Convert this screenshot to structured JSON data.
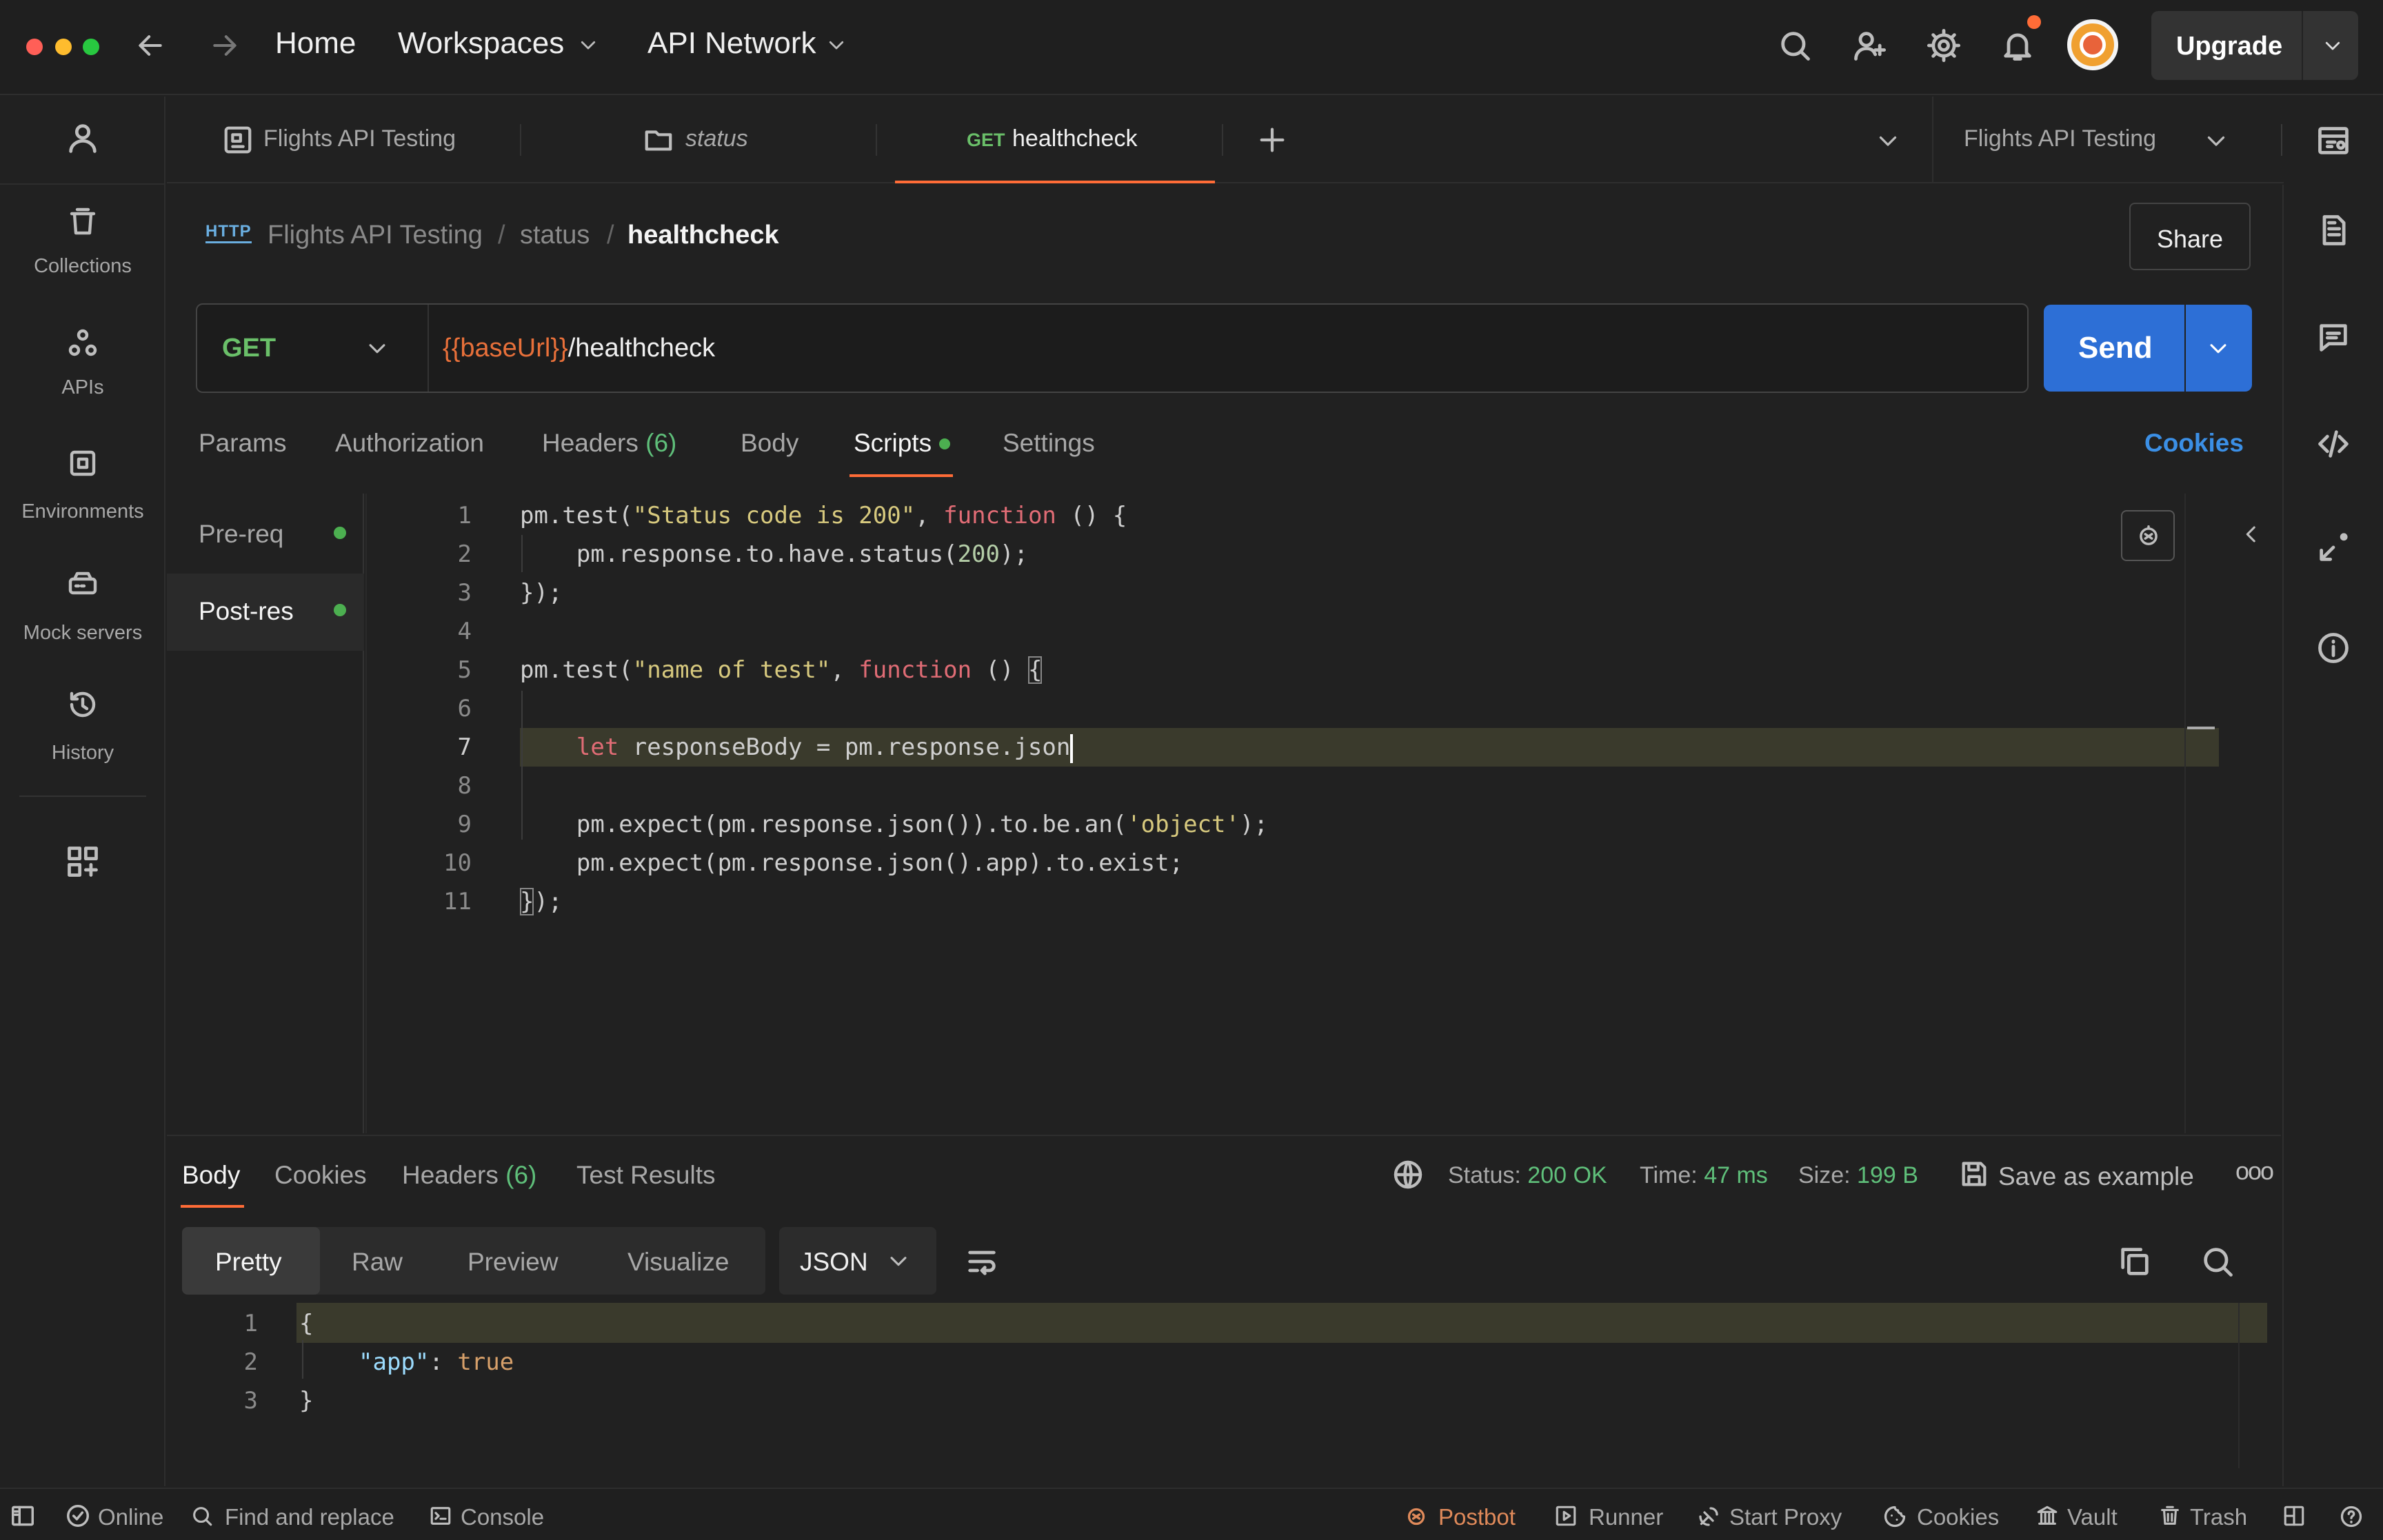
{
  "topbar": {
    "home": "Home",
    "workspaces": "Workspaces",
    "api_network": "API Network",
    "upgrade": "Upgrade"
  },
  "tabs": {
    "items": [
      {
        "label": "Flights API Testing"
      },
      {
        "label": "status"
      },
      {
        "method": "GET",
        "label": "healthcheck"
      }
    ],
    "environment": "Flights API Testing"
  },
  "sidebar": {
    "items": [
      {
        "label": "Collections"
      },
      {
        "label": "APIs"
      },
      {
        "label": "Environments"
      },
      {
        "label": "Mock servers"
      },
      {
        "label": "History"
      }
    ]
  },
  "breadcrumb": {
    "collection": "Flights API Testing",
    "sep1": "/",
    "folder": "status",
    "sep2": "/",
    "request": "healthcheck",
    "share": "Share"
  },
  "request": {
    "method": "GET",
    "url_var": "{{baseUrl}}",
    "url_path": "/healthcheck",
    "send": "Send"
  },
  "request_tabs": {
    "params": "Params",
    "authorization": "Authorization",
    "headers": "Headers",
    "headers_count": "(6)",
    "body": "Body",
    "scripts": "Scripts",
    "settings": "Settings",
    "cookies": "Cookies"
  },
  "scripts": {
    "pre_req": "Pre-req",
    "post_res": "Post-res"
  },
  "code_lines": [
    "1",
    "2",
    "3",
    "4",
    "5",
    "6",
    "7",
    "8",
    "9",
    "10",
    "11"
  ],
  "code": {
    "l1a": "pm.test(",
    "l1b": "\"Status code is 200\"",
    "l1c": ", ",
    "l1d": "function",
    "l1e": " () {",
    "l2a": "    pm.response.to.have.status(",
    "l2b": "200",
    "l2c": ");",
    "l3": "});",
    "l5a": "pm.test(",
    "l5b": "\"name of test\"",
    "l5c": ", ",
    "l5d": "function",
    "l5e": " () ",
    "l5f": "{",
    "l7a": "    ",
    "l7b": "let",
    "l7c": " responseBody = pm.response.json",
    "l9a": "    pm.expect(pm.response.json()).to.be.an(",
    "l9b": "'object'",
    "l9c": ");",
    "l10": "    pm.expect(pm.response.json().app).to.exist;",
    "l11a": "}",
    "l11b": ");"
  },
  "response": {
    "tabs": {
      "body": "Body",
      "cookies": "Cookies",
      "headers": "Headers",
      "headers_count": "(6)",
      "test_results": "Test Results"
    },
    "status_label": "Status:",
    "status_value": "200 OK",
    "time_label": "Time:",
    "time_value": "47 ms",
    "size_label": "Size:",
    "size_value": "199 B",
    "save_example": "Save as example",
    "views": {
      "pretty": "Pretty",
      "raw": "Raw",
      "preview": "Preview",
      "visualize": "Visualize"
    },
    "format": "JSON",
    "lines": [
      "1",
      "2",
      "3"
    ],
    "body": {
      "l1": "{",
      "l2a": "\"app\"",
      "l2b": ": ",
      "l2c": "true",
      "l3": "}"
    }
  },
  "statusbar": {
    "online": "Online",
    "find_replace": "Find and replace",
    "console": "Console",
    "postbot": "Postbot",
    "runner": "Runner",
    "start_proxy": "Start Proxy",
    "cookies": "Cookies",
    "vault": "Vault",
    "trash": "Trash"
  },
  "colors": {
    "accent": "#ff6c37",
    "send_button": "#2d6fd6",
    "link_blue": "#3b8fe5",
    "success_green": "#5fbf7a",
    "method_green": "#6abf69",
    "line_highlight": "#3a3a2c"
  }
}
